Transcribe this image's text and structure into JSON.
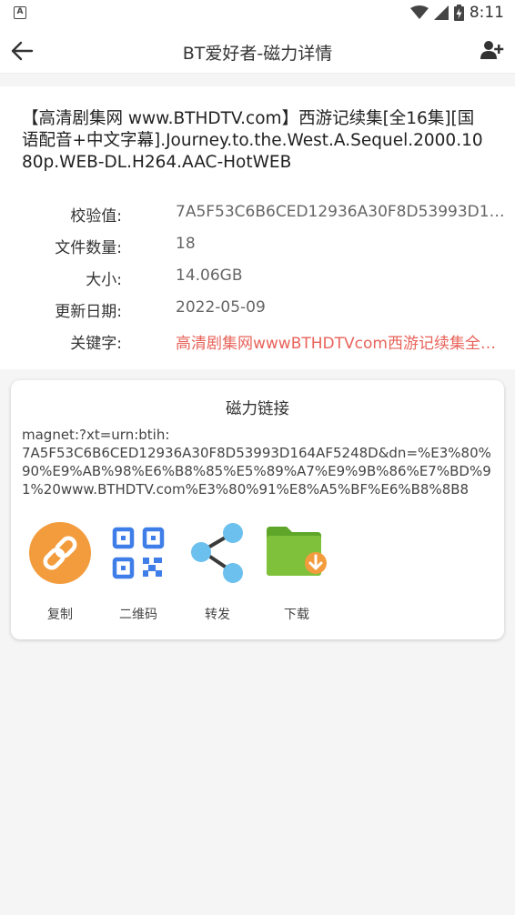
{
  "status_bar": {
    "time": "8:11",
    "left_icon_letter": "A",
    "icons": [
      "wifi-icon",
      "cell-signal-icon",
      "battery-charging-icon"
    ]
  },
  "app_bar": {
    "title": "BT爱好者-磁力详情",
    "back_icon": "arrow-left-icon",
    "action_icon": "add-user-icon"
  },
  "torrent": {
    "title": "【高清剧集网 www.BTHDTV.com】西游记续集[全16集][国语配音+中文字幕].Journey.to.the.West.A.Sequel.2000.1080p.WEB-DL.H264.AAC-HotWEB",
    "fields": [
      {
        "label": "校验值:",
        "value": "7A5F53C6B6CED12936A30F8D53993D16…"
      },
      {
        "label": "文件数量:",
        "value": "18"
      },
      {
        "label": "大小:",
        "value": "14.06GB"
      },
      {
        "label": "更新日期:",
        "value": "2022-05-09"
      },
      {
        "label": "关键字:",
        "value": "高清剧集网wwwBTHDTVcom西游记续集全…"
      }
    ]
  },
  "magnet": {
    "title": "磁力链接",
    "link": "magnet:?xt=urn:btih:\n7A5F53C6B6CED12936A30F8D53993D164AF5248D&dn=%E3%80%90%E9%AB%98%E6%B8%85%E5%89%A7%E9%9B%86%E7%BD%91%20www.BTHDTV.com%E3%80%91%E8%A5%BF%E6%B8%8B8",
    "actions": [
      {
        "label": "复制",
        "icon": "link-icon"
      },
      {
        "label": "二维码",
        "icon": "qr-code-icon"
      },
      {
        "label": "转发",
        "icon": "share-icon"
      },
      {
        "label": "下载",
        "icon": "folder-download-icon"
      }
    ]
  },
  "colors": {
    "keyword": "#e8635a",
    "copy_icon_bg": "#f39c3d",
    "qr_blue": "#3f7ee8",
    "share_blue": "#6cc0ee",
    "folder_green": "#7fc13a",
    "download_badge": "#f39c3d"
  }
}
